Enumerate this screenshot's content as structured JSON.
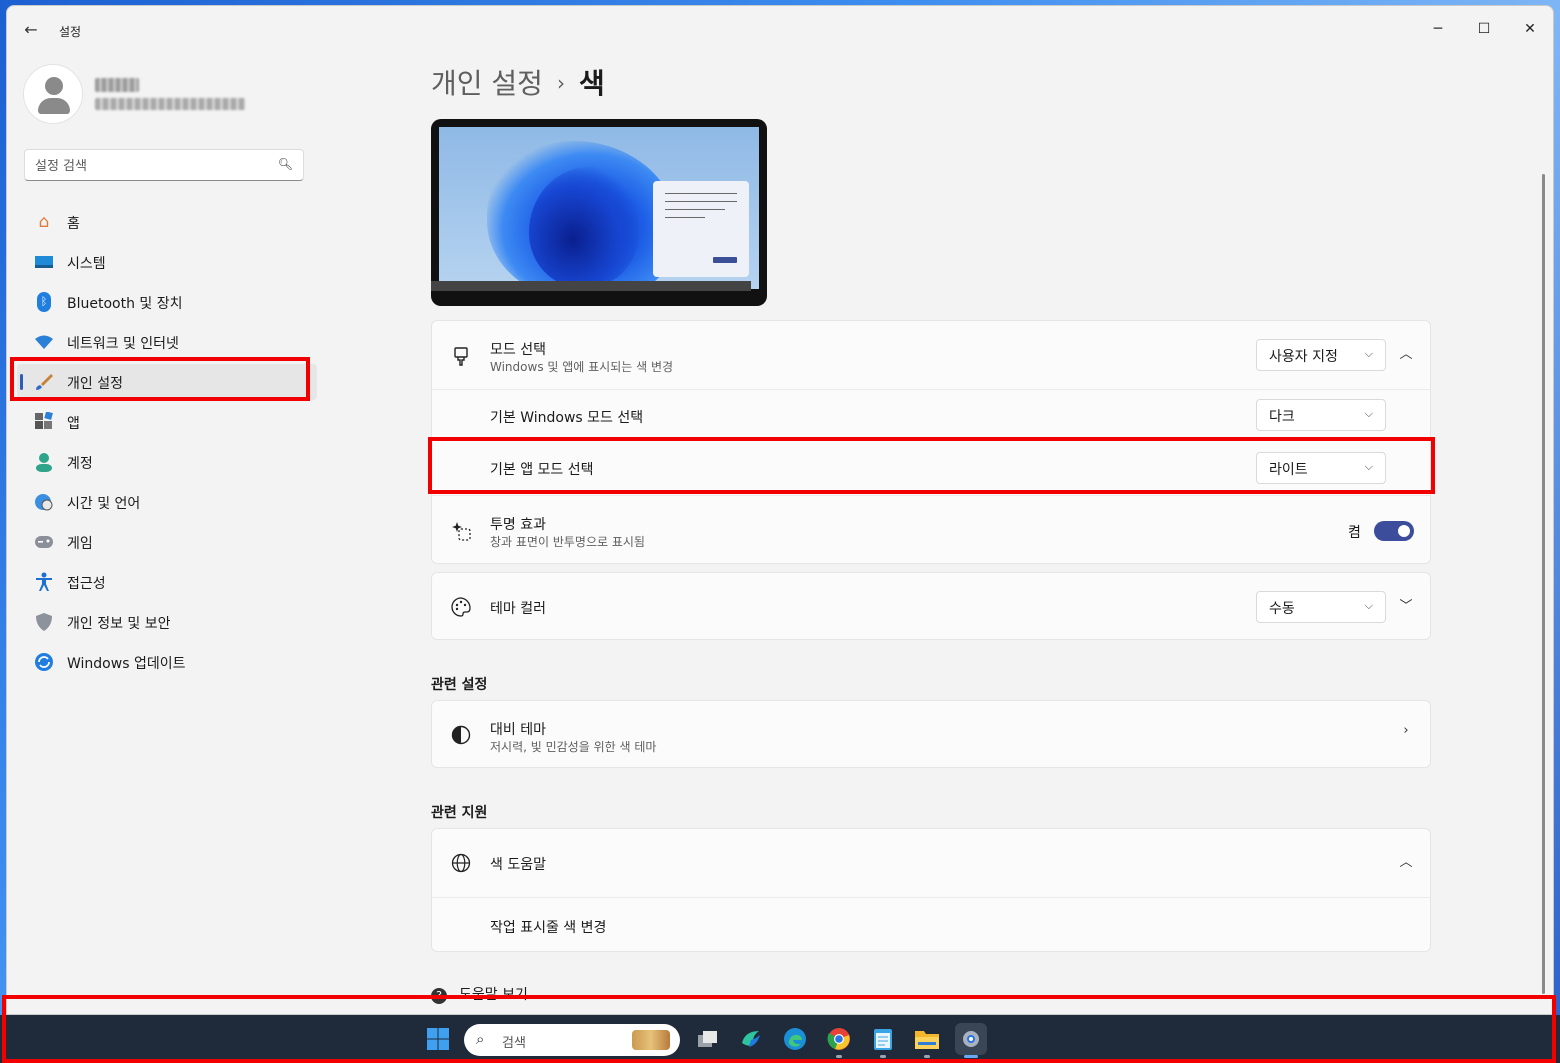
{
  "window": {
    "title": "설정",
    "controls": {
      "minimize": "─",
      "maximize": "☐",
      "close": "✕"
    }
  },
  "sidebar": {
    "search_placeholder": "설정 검색",
    "items": [
      {
        "label": "홈",
        "icon": "home-icon"
      },
      {
        "label": "시스템",
        "icon": "system-icon"
      },
      {
        "label": "Bluetooth 및 장치",
        "icon": "bluetooth-icon"
      },
      {
        "label": "네트워크 및 인터넷",
        "icon": "wifi-icon"
      },
      {
        "label": "개인 설정",
        "icon": "brush-icon",
        "active": true
      },
      {
        "label": "앱",
        "icon": "apps-icon"
      },
      {
        "label": "계정",
        "icon": "account-icon"
      },
      {
        "label": "시간 및 언어",
        "icon": "globe-clock-icon"
      },
      {
        "label": "게임",
        "icon": "gamepad-icon"
      },
      {
        "label": "접근성",
        "icon": "accessibility-icon"
      },
      {
        "label": "개인 정보 및 보안",
        "icon": "shield-icon"
      },
      {
        "label": "Windows 업데이트",
        "icon": "update-icon"
      }
    ]
  },
  "breadcrumb": {
    "parent": "개인 설정",
    "separator": "›",
    "current": "색"
  },
  "mode_card": {
    "mode": {
      "title": "모드 선택",
      "subtitle": "Windows 및 앱에 표시되는 색 변경",
      "value": "사용자 지정"
    },
    "windows_mode": {
      "title": "기본 Windows 모드 선택",
      "value": "다크"
    },
    "app_mode": {
      "title": "기본 앱 모드 선택",
      "value": "라이트"
    },
    "transparency": {
      "title": "투명 효과",
      "subtitle": "창과 표면이 반투명으로 표시됨",
      "state_label": "켬",
      "on": true
    }
  },
  "theme_color": {
    "title": "테마 컬러",
    "value": "수동"
  },
  "related_settings": {
    "heading": "관련 설정",
    "contrast": {
      "title": "대비 테마",
      "subtitle": "저시력, 빛 민감성을 위한 색 테마"
    }
  },
  "related_support": {
    "heading": "관련 지원",
    "color_help": {
      "title": "색 도움말"
    },
    "taskbar_color": {
      "title": "작업 표시줄 색 변경"
    }
  },
  "help": {
    "label": "도움말 보기"
  },
  "taskbar": {
    "search_label": "검색",
    "icons": [
      "start-icon",
      "task-view-icon",
      "copilot-icon",
      "edge-icon",
      "chrome-icon",
      "notepad-icon",
      "file-explorer-icon",
      "settings-icon"
    ]
  },
  "colors": {
    "accent": "#3c4e9b",
    "highlight": "#f20000"
  }
}
